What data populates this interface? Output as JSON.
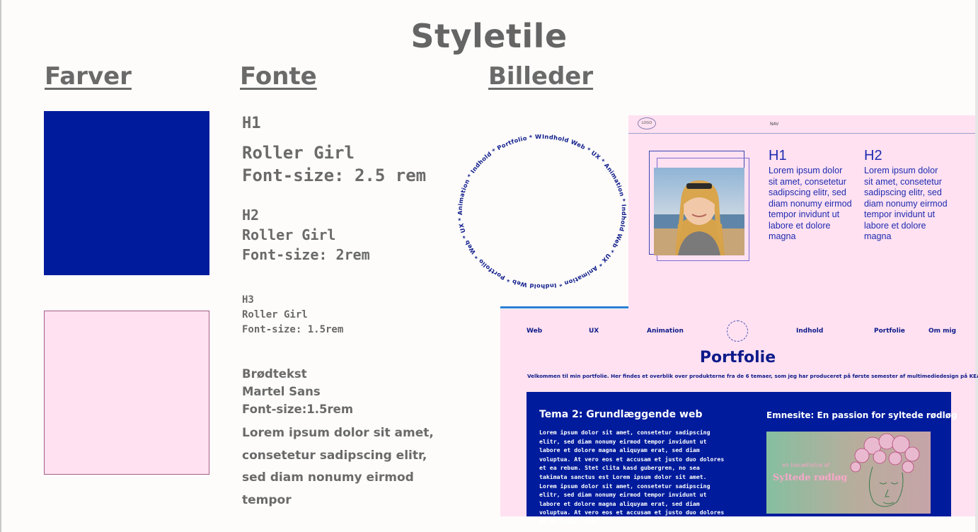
{
  "page": {
    "title": "Styletile"
  },
  "sections": {
    "colors": "Farver",
    "fonts": "Fonte",
    "images": "Billeder"
  },
  "colors": {
    "primary": "#001b9c",
    "secondary": "#ffe1f1",
    "secondary_border": "#a35d87"
  },
  "fonts": {
    "h1": {
      "tag": "H1",
      "family": "Roller Girl",
      "size": "Font-size: 2.5 rem"
    },
    "h2": {
      "tag": "H2",
      "family": "Roller Girl",
      "size": "Font-size: 2rem"
    },
    "h3": {
      "tag": "H3",
      "family": "Roller Girl",
      "size": "Font-size: 1.5rem"
    },
    "body": {
      "tag": "Brødtekst",
      "family": "Martel Sans",
      "size": "Font-size:1.5rem",
      "sample": "Lorem ipsum dolor sit amet, consetetur sadipscing elitr, sed diam nonumy eirmod tempor"
    }
  },
  "circle_text": "Indhold Web * UX * Animation * Indhold Web * UX * Animation * Indhold Web * Portfolio * Web * UX * Animation * Indhold * Portfolio * Web * UX * Animation * ",
  "mockup1": {
    "logo": "LOGO",
    "nav": "NAV",
    "h1": "H1",
    "h1_text": "Lorem ipsum dolor sit amet, consetetur sadipscing elitr, sed diam nonumy eirmod tempor invidunt ut labore et dolore magna",
    "h2": "H2",
    "h2_text": "Lorem ipsum dolor sit amet, consetetur sadipscing elitr, sed diam nonumy eirmod tempor invidunt ut labore et dolore magna"
  },
  "mockup2": {
    "nav": [
      "Web",
      "UX",
      "Animation",
      "Indhold",
      "Portfolie",
      "Om mig"
    ],
    "title": "Portfolie",
    "intro": "Velkommen til min portfolie. Her findes et overblik over produkterne fra de 6 temaer, som jeg har produceret på første semester af multimediedesign på KEA.",
    "card1_title": "Tema 2: Grundlæggende web",
    "card1_text": "Lorem ipsum dolor sit amet, consetetur sadipscing elitr, sed diam nonumy eirmod tempor invidunt ut labore et dolore magna aliquyam erat, sed diam voluptua. At vero eos et accusam et justo duo dolores et ea rebum. Stet clita kasd gubergren, no sea takimata sanctus est Lorem ipsum dolor sit amet. Lorem ipsum dolor sit amet, consetetur sadipscing elitr, sed diam nonumy eirmod tempor invidunt ut labore et dolore magna aliquyam erat, sed diam voluptua. At vero eos et accusam et justo duo dolores et ea rebum. Stet",
    "card2_title": "Emnesite: En passion for syltede rødløg",
    "card2_small": "en besættelse af",
    "card2_big": "Syltede rødløg"
  }
}
